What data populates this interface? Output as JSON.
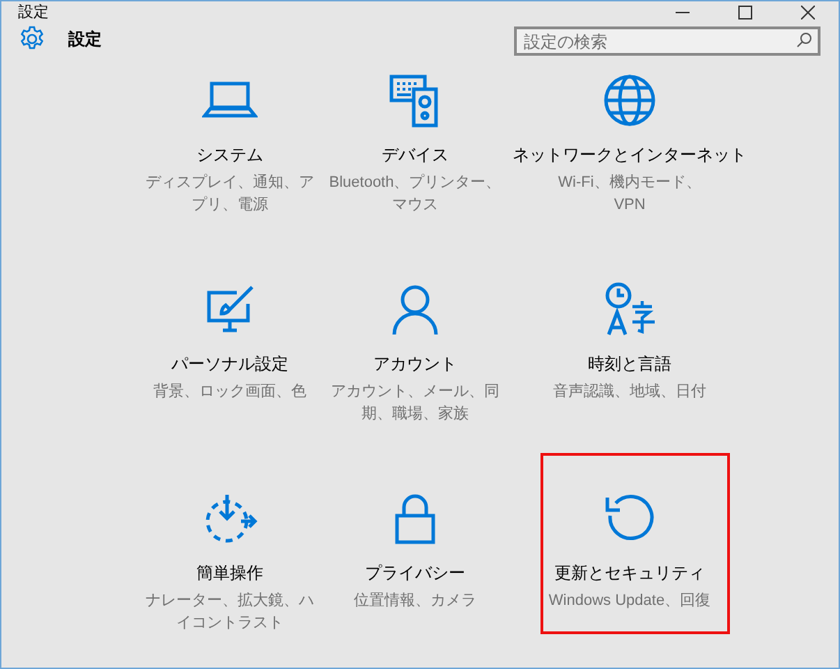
{
  "window": {
    "title": "設定"
  },
  "header": {
    "title": "設定"
  },
  "search": {
    "placeholder": "設定の検索"
  },
  "items": [
    {
      "kind": "laptop",
      "title": "システム",
      "subtitle": "ディスプレイ、通知、アプリ、電源",
      "highlighted": false
    },
    {
      "kind": "devices",
      "title": "デバイス",
      "subtitle": "Bluetooth、プリンター、マウス",
      "highlighted": false
    },
    {
      "kind": "globe",
      "title": "ネットワークとインターネット",
      "subtitle": "Wi-Fi、機内モード、VPN",
      "highlighted": false
    },
    {
      "kind": "paint",
      "title": "パーソナル設定",
      "subtitle": "背景、ロック画面、色",
      "highlighted": false
    },
    {
      "kind": "person",
      "title": "アカウント",
      "subtitle": "アカウント、メール、同期、職場、家族",
      "highlighted": false
    },
    {
      "kind": "time",
      "title": "時刻と言語",
      "subtitle": "音声認識、地域、日付",
      "highlighted": false
    },
    {
      "kind": "ease",
      "title": "簡単操作",
      "subtitle": "ナレーター、拡大鏡、ハイコントラスト",
      "highlighted": false
    },
    {
      "kind": "lock",
      "title": "プライバシー",
      "subtitle": "位置情報、カメラ",
      "highlighted": false
    },
    {
      "kind": "update",
      "title": "更新とセキュリティ",
      "subtitle": "Windows Update、回復",
      "highlighted": true
    }
  ]
}
